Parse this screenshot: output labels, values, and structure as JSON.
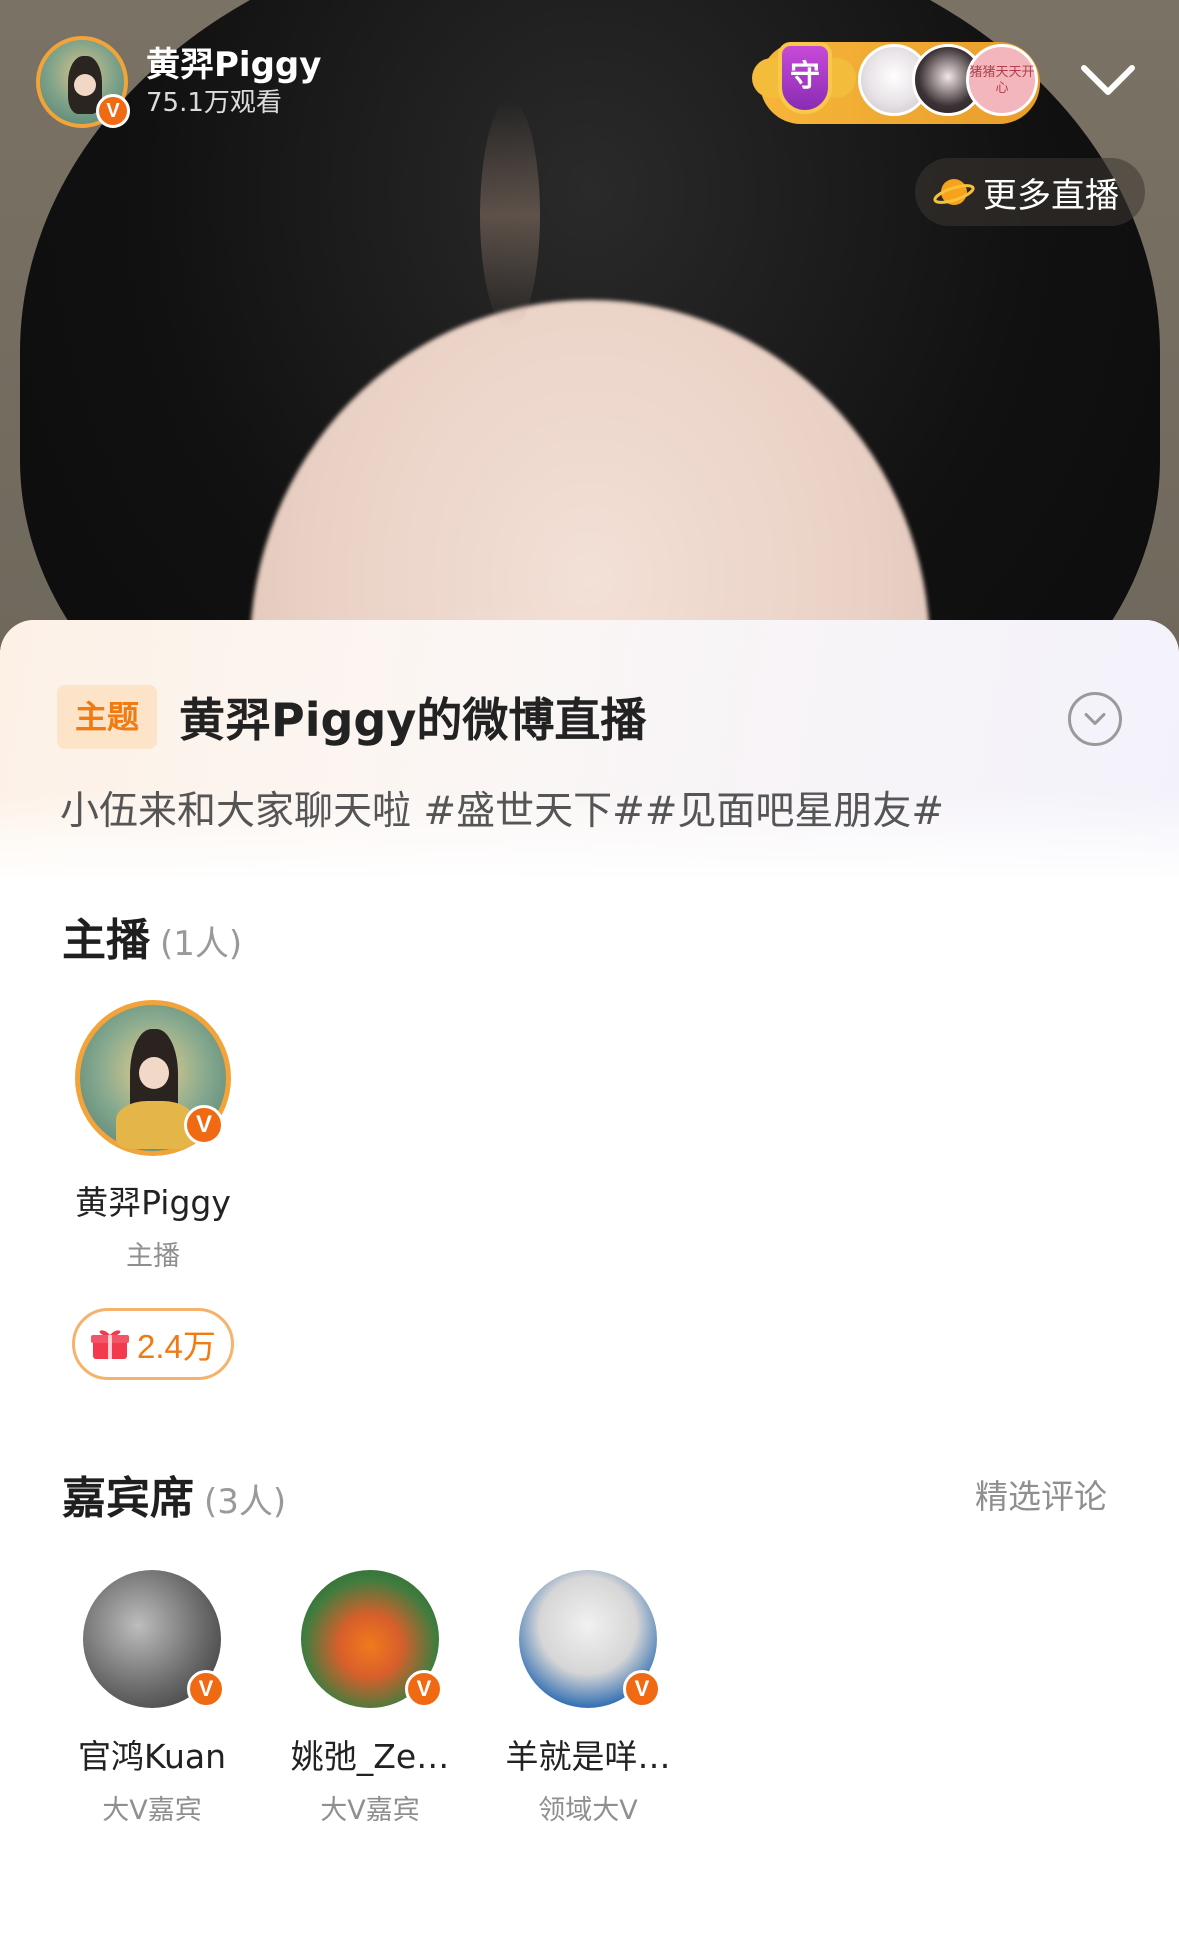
{
  "header": {
    "host_name": "黄羿Piggy",
    "view_count": "75.1万观看",
    "guard_icon_char": "守",
    "fan3_text": "猪猪天天开心",
    "more_live_label": "更多直播"
  },
  "topic": {
    "tag": "主题",
    "title": "黄羿Piggy的微博直播",
    "description": "小伍来和大家聊天啦 #盛世天下##见面吧星朋友#"
  },
  "anchors": {
    "title": "主播",
    "count": "(1人)",
    "items": [
      {
        "name": "黄羿Piggy",
        "role": "主播",
        "gift": "2.4万"
      }
    ]
  },
  "guests": {
    "title": "嘉宾席",
    "count": "(3人)",
    "featured_label": "精选评论",
    "items": [
      {
        "name": "官鸿Kuan",
        "role": "大V嘉宾"
      },
      {
        "name": "姚弛_Ze…",
        "role": "大V嘉宾"
      },
      {
        "name": "羊就是咩…",
        "role": "领域大V"
      }
    ]
  },
  "badge_letter": "V",
  "colors": {
    "accent_orange": "#f07b12",
    "verify_badge": "#f06a14",
    "avatar_ring": "#f2a33a",
    "guard_gold": "#f6b63a"
  },
  "icons": {
    "guard": "shield-icon",
    "collapse": "chevron-down-icon",
    "more_live": "planet-icon",
    "expand": "circle-chevron-icon",
    "gift": "gift-icon"
  }
}
